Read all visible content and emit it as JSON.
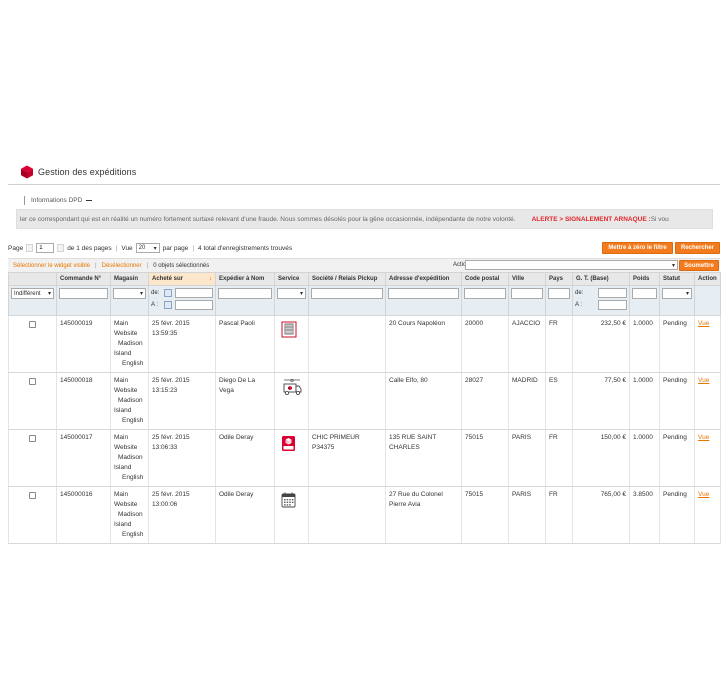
{
  "header": {
    "title": "Gestion des expéditions",
    "brand_color": "#dc0032"
  },
  "tab": {
    "label": "Informations DPD"
  },
  "notice": {
    "text": "ler ce correspondant qui est en réalité un numéro fortement surtaxé relevant d'une fraude. Nous sommes désolés pour la gêne occasionnée, indépendante de notre volonté.",
    "alert": "ALERTE > SIGNALEMENT ARNAQUE :",
    "after": " Si vou"
  },
  "pager": {
    "page_label": "Page",
    "page_value": "1",
    "of_pages": "de 1 des pages",
    "view_label": "Vue",
    "per_page_value": "20",
    "per_page_label": "par page",
    "total": "4 total d'enregistrements trouvés",
    "reset_button": "Mettre à zéro le filtre",
    "search_button": "Rechercher"
  },
  "massaction": {
    "select_visible": "Sélectionner le widget visible",
    "deselect": "Désélectionner",
    "selected_count": "0 objets sélectionnés",
    "action_label": "Action",
    "submit_button": "Soumettre"
  },
  "columns": [
    "",
    "Commande N°",
    "Magasin",
    "Acheté sur",
    "Expédier à Nom",
    "Service",
    "Société / Relais Pickup",
    "Adresse d'expédition",
    "Code postal",
    "Ville",
    "Pays",
    "G. T. (Base)",
    "Poids",
    "Statut",
    "Action"
  ],
  "filters": {
    "mass_select": "Indifférent",
    "from_label": "de:",
    "to_label": "A :"
  },
  "accent_color": "#f37b1d",
  "rows": [
    {
      "order": "145000019",
      "store": [
        "Main",
        "Website",
        "Madison",
        "Island",
        "English"
      ],
      "date": "25 févr. 2015",
      "time": "13:59:35",
      "name": "Pascal Paoli",
      "service_icon": "building-icon",
      "company": "",
      "address": "20 Cours Napoléon",
      "postcode": "20000",
      "city": "AJACCIO",
      "country": "FR",
      "total": "232,50 €",
      "weight": "1.0000",
      "status": "Pending",
      "action": "Vue"
    },
    {
      "order": "145000018",
      "store": [
        "Main",
        "Website",
        "Madison",
        "Island",
        "English"
      ],
      "date": "25 févr. 2015",
      "time": "13:15:23",
      "name": "Diego De La Vega",
      "service_icon": "delivery-truck-icon",
      "company": "",
      "address": "Calle Elfo, 80",
      "postcode": "28027",
      "city": "MADRID",
      "country": "ES",
      "total": "77,50 €",
      "weight": "1.0000",
      "status": "Pending",
      "action": "Vue"
    },
    {
      "order": "145000017",
      "store": [
        "Main",
        "Website",
        "Madison",
        "Island",
        "English"
      ],
      "date": "25 févr. 2015",
      "time": "13:06:33",
      "name": "Odile Deray",
      "service_icon": "pickup-relay-icon",
      "company": "CHIC PRIMEUR P34375",
      "address": "135 RUE SAINT CHARLES",
      "postcode": "75015",
      "city": "PARIS",
      "country": "FR",
      "total": "150,00 €",
      "weight": "1.0000",
      "status": "Pending",
      "action": "Vue"
    },
    {
      "order": "145000016",
      "store": [
        "Main",
        "Website",
        "Madison",
        "Island",
        "English"
      ],
      "date": "25 févr. 2015",
      "time": "13:00:06",
      "name": "Odile Deray",
      "service_icon": "calendar-icon",
      "company": "",
      "address": "27 Rue du Colonel Pierre Avia",
      "postcode": "75015",
      "city": "PARIS",
      "country": "FR",
      "total": "765,00 €",
      "weight": "3.8500",
      "status": "Pending",
      "action": "Vue"
    }
  ]
}
